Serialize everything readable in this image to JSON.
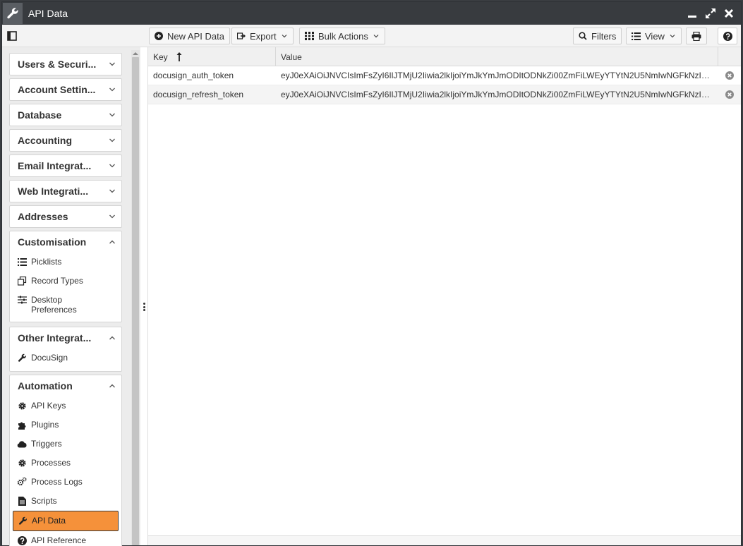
{
  "window": {
    "title": "API Data"
  },
  "toolbar": {
    "new_label": "New API Data",
    "export_label": "Export",
    "bulk_label": "Bulk Actions",
    "filters_label": "Filters",
    "view_label": "View"
  },
  "sidebar": {
    "sections": [
      {
        "label": "Users & Securi..."
      },
      {
        "label": "Account Settin..."
      },
      {
        "label": "Database"
      },
      {
        "label": "Accounting"
      },
      {
        "label": "Email Integrat..."
      },
      {
        "label": "Web Integrati..."
      },
      {
        "label": "Addresses"
      },
      {
        "label": "Customisation",
        "items": [
          {
            "label": "Picklists",
            "icon": "list-icon"
          },
          {
            "label": "Record Types",
            "icon": "record-types-icon"
          },
          {
            "label": "Desktop Preferences",
            "icon": "sliders-icon"
          }
        ]
      },
      {
        "label": "Other Integrat...",
        "items": [
          {
            "label": "DocuSign",
            "icon": "wrench-icon"
          }
        ]
      },
      {
        "label": "Automation",
        "items": [
          {
            "label": "API Keys",
            "icon": "gear-icon"
          },
          {
            "label": "Plugins",
            "icon": "puzzle-icon"
          },
          {
            "label": "Triggers",
            "icon": "cloud-icon"
          },
          {
            "label": "Processes",
            "icon": "gear-icon"
          },
          {
            "label": "Process Logs",
            "icon": "gears-icon"
          },
          {
            "label": "Scripts",
            "icon": "document-icon"
          },
          {
            "label": "API Data",
            "icon": "wrench-icon",
            "active": true
          },
          {
            "label": "API Reference",
            "icon": "question-icon"
          }
        ]
      }
    ]
  },
  "grid": {
    "columns": [
      {
        "label": "Key",
        "sort": "ascending"
      },
      {
        "label": "Value"
      }
    ],
    "rows": [
      {
        "key": "docusign_auth_token",
        "value": "eyJ0eXAiOiJNVCIsImFsZyI6IlJTMjU2Iiwia2lkIjoiYmJkYmJmODItODNkZi00ZmFiLWEyYTYtN2U5NmIwNGFkNzImI..."
      },
      {
        "key": "docusign_refresh_token",
        "value": "eyJ0eXAiOiJNVCIsImFsZyI6IlJTMjU2Iiwia2lkIjoiYmJkYmJmODItODNkZi00ZmFiLWEyYTYtN2U5NmIwNGFkNzImI..."
      }
    ]
  },
  "colors": {
    "active_item": "#f5913a",
    "titlebar": "#383b3f"
  }
}
